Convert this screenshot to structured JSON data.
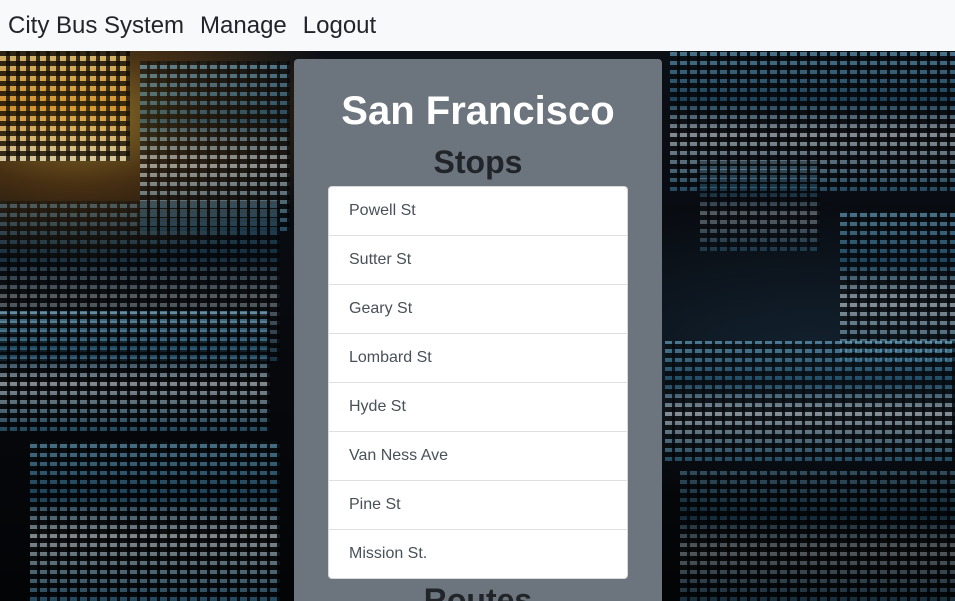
{
  "navbar": {
    "brand": "City Bus System",
    "manage": "Manage",
    "logout": "Logout"
  },
  "panel": {
    "city": "San Francisco",
    "stops_heading": "Stops",
    "routes_heading": "Routes",
    "stops": [
      "Powell St",
      "Sutter St",
      "Geary St",
      "Lombard St",
      "Hyde St",
      "Van Ness Ave",
      "Pine St",
      "Mission St."
    ]
  },
  "colors": {
    "navbar_bg": "#f8f9fa",
    "panel_bg": "#6c757d",
    "title_text": "#ffffff",
    "heading_text": "#212529",
    "list_text": "#495057"
  }
}
